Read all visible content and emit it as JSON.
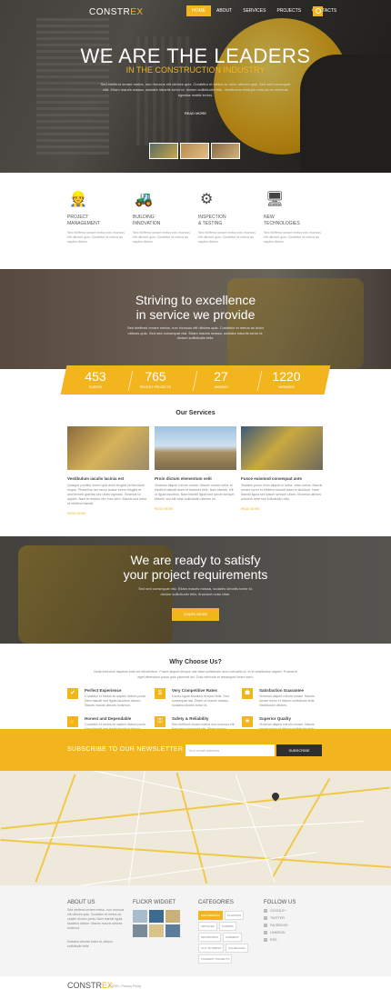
{
  "header": {
    "logo_a": "CONSTR",
    "logo_b": "EX",
    "nav": [
      "HOME",
      "ABOUT",
      "SERVICES",
      "PROJECTS",
      "CONTACTS"
    ],
    "active_nav": "HOME"
  },
  "hero": {
    "title": "WE ARE THE LEADERS",
    "subtitle": "IN THE CONSTRUCTION INDUSTRY",
    "text": "Sed eleifend ornare metus, non rhoncus elit ultrices quis. Curabitur et metus ac dolor ultrices quis. Sed sed consequat nisl. Etiam mauris massa, sodales lobortis tortor id, dictum sollicitudin felis. Vestibulum tristique urna ac ex vehicula egestas mattis lectus.",
    "read_more": "READ MORE"
  },
  "features": [
    {
      "title1": "PROJECT",
      "title2": "MANAGEMENT",
      "icon": "worker-icon",
      "text": "Sed eleifend ornare metus non rhoncus elit ultrices quis. Curabitur et metus ac sapien dictum."
    },
    {
      "title1": "BUILDING",
      "title2": "INNOVATION",
      "icon": "excavator-icon",
      "text": "Sed eleifend ornare metus non rhoncus elit ultrices quis. Curabitur et metus ac sapien dictum."
    },
    {
      "title1": "INSPECTION",
      "title2": "& TESTING",
      "icon": "gear-icon",
      "text": "Sed eleifend ornare metus non rhoncus elit ultrices quis. Curabitur et metus ac sapien dictum."
    },
    {
      "title1": "NEW",
      "title2": "TECHNOLOGIES",
      "icon": "computer-icon",
      "text": "Sed eleifend ornare metus non rhoncus elit ultrices quis. Curabitur et metus ac sapien dictum."
    }
  ],
  "excellence": {
    "line1": "Striving to excellence",
    "line2": "in service we provide",
    "text": "Sed eleifend ornare metus, non rhoncus elit ultrices quis. Curabitur et metus ac dolor ultrices quis. Sed sed consequat nisl. Etiam mauris massa, sodales lobortis tortor id, dictum sollicitudin felis."
  },
  "stats": [
    {
      "num": "453",
      "label": "CLIENTS"
    },
    {
      "num": "765",
      "label": "RECENT PROJECTS"
    },
    {
      "num": "27",
      "label": "AWARDS"
    },
    {
      "num": "1220",
      "label": "MEMBERS"
    }
  ],
  "services": {
    "heading": "Our Services",
    "items": [
      {
        "title": "Vestibulum iaculis lacinia est",
        "text": "Quisque porttitor lorem quis dolor feugiat vel tincidunt neque. Phasellus nec lacus auctor lorem fringilla et amehendrit gravida nec ullam egestas. Vivamus ut sapien. Nam et mauris nec eros sem. Mauris sed tortor ut eleifend blandit.",
        "more": "READ MORE"
      },
      {
        "title": "Proin dictum elementum velit",
        "text": "Vivamus aliquet rutrum ornare. Mauris ornare tortor et eleifend blandit diam et tincidunt felis. Nam blandit, elit ut ligula faucibus. Nam blandit ligula sed ipsum semper. Mauris non elit vitae sollicitudin ultrices mi.",
        "more": "READ MORE"
      },
      {
        "title": "Fusce euismod consequat ante",
        "text": "Sodales purus enim aliquet in tortor, vitae varius. Mauris ornare tortor et eleifend blandit diam et tincidunt. Nam blandit ligula sed ipsum semper ullam. Vivamus ultrices posuere ante sed sollicitudin odio.",
        "more": "READ MORE"
      }
    ]
  },
  "ready": {
    "line1": "We are ready to satisfy",
    "line2": "your project requirements",
    "text": "Sed sed consequat nisl. Etiam mauris massa, sodales lobortis tortor id, dictum sollicitudin felis, tincidunt nulla vitae.",
    "button": "LEARN MORE"
  },
  "why": {
    "heading": "Why Choose Us?",
    "text": "Nulla interdum dapibus erat vel elementum. Fusce aliquet tempor nisl vitae sollicitudin arcu convallis id. In id vestibulum sapien. Praesent eget bibendum purus quis placerat dui. Duis vehicula et amanquet lorem sem.",
    "items": [
      {
        "title": "Perfect Experience",
        "icon": "thumbs-up-icon",
        "glyph": "✔",
        "text": "Curabitur et metus ac sapien dictum porta. Nam blandit sed ligula faucibus dictum. Mauris mauris ultrices euismod."
      },
      {
        "title": "Very Competitive Rates",
        "icon": "dollar-icon",
        "glyph": "$",
        "text": "Donec ligula faucibus tempus felis. Sed consequat nisl. Etiam ut mauris massa, sodales lobortis tortor id."
      },
      {
        "title": "Satisfaction Guarantee",
        "icon": "car-icon",
        "glyph": "☗",
        "text": "Vivamus aliquet rutrum ornare. Mauris ornare tortor et dictum sollicitudin felis. Vestibulum ultrices."
      },
      {
        "title": "Honest and Dependable",
        "icon": "handshake-icon",
        "glyph": "✋",
        "text": "Curabitur et metus ac sapien dictum porta. Nam blandit sed ligula faucibus dictum. Mauris mauris ultrices euismod."
      },
      {
        "title": "Safety & Reliability",
        "icon": "lock-icon",
        "glyph": "🔒",
        "text": "Sed eleifend ornare metus non rhoncus elit. Sed sed consequat nisl. Etiam mauris massa sodales."
      },
      {
        "title": "Superior Quality",
        "icon": "award-icon",
        "glyph": "★",
        "text": "Vivamus aliquet rutrum ornare. Mauris ornare tortor et dictum sollicitudin felis. Vestibulum ultrices."
      }
    ]
  },
  "newsletter": {
    "title": "SUBSCRIBE TO OUR NEWSLETTER",
    "placeholder": "Your email address",
    "button": "SUBSCRIBE"
  },
  "footer": {
    "about_title": "ABOUT US",
    "about_text1": "Sed eleifend ornare metus, non rhoncus elit ultrices quis. Curabitur et metus ac sapien dictum porta. Nam blandit ligula faucibus dictum. Mauris mauris ultrices euismod.",
    "about_text2": "Sodales lobortis tortor id, dictum sollicitudin felis.",
    "flickr_title": "FLICKR WIDGET",
    "categories_title": "CATEGORIES",
    "categories": [
      "ENGINEERING",
      "PLANNING",
      "ARTICLES",
      "TOWERS",
      "IRONWORKS",
      "CURRENT",
      "OUT OF PRESS",
      "SCHEDULES",
      "CURRENT PROJECTS"
    ],
    "follow_title": "FOLLOW US",
    "follow": [
      "GOOGLE+",
      "TWITTER",
      "FACEBOOK",
      "LINKEDIN",
      "RSS"
    ],
    "copyright": "© 2015 • Privacy Policy"
  }
}
